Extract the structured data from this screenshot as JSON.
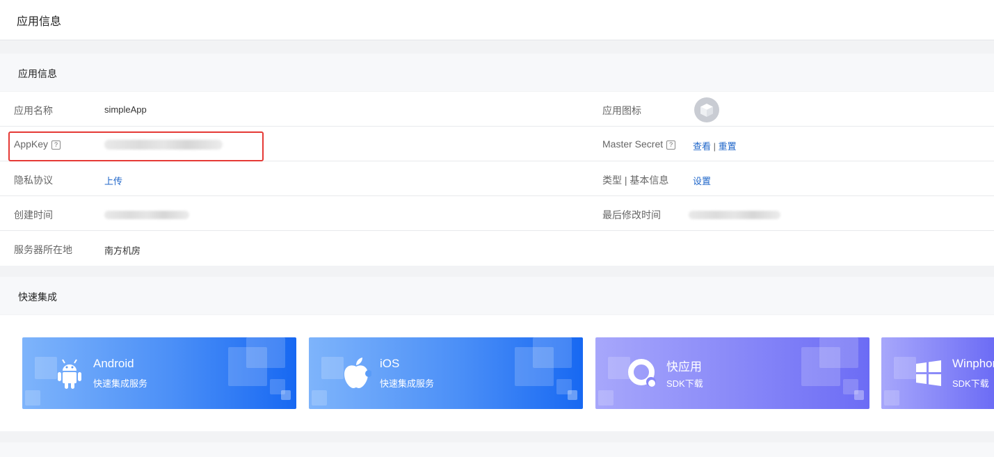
{
  "header": {
    "title": "应用信息"
  },
  "app_info": {
    "section_title": "应用信息",
    "rows": [
      {
        "left_label": "应用名称",
        "left_value": "simpleApp",
        "right_label": "应用图标"
      },
      {
        "left_label": "AppKey",
        "right_label": "Master Secret",
        "right_link_view": "查看",
        "right_separator": "|",
        "right_link_reset": "重置"
      },
      {
        "left_label": "隐私协议",
        "left_link": "上传",
        "right_label": "类型 | 基本信息",
        "right_link": "设置"
      },
      {
        "left_label": "创建时间",
        "right_label": "最后修改时间"
      },
      {
        "left_label": "服务器所在地",
        "left_value": "南方机房"
      }
    ],
    "help_icon": "?"
  },
  "quick_integration": {
    "section_title": "快速集成",
    "cards": [
      {
        "name": "Android",
        "sub": "快速集成服务",
        "icon": "android-icon",
        "color": "#1768f2"
      },
      {
        "name": "iOS",
        "sub": "快速集成服务",
        "icon": "apple-icon",
        "color": "#1768f2"
      },
      {
        "name": "快应用",
        "sub": "SDK下载",
        "icon": "quickapp-icon",
        "color": "#6c6cf5"
      },
      {
        "name": "Winphone",
        "sub": "SDK下载",
        "icon": "windows-icon",
        "color": "#6c6cf5"
      }
    ]
  }
}
